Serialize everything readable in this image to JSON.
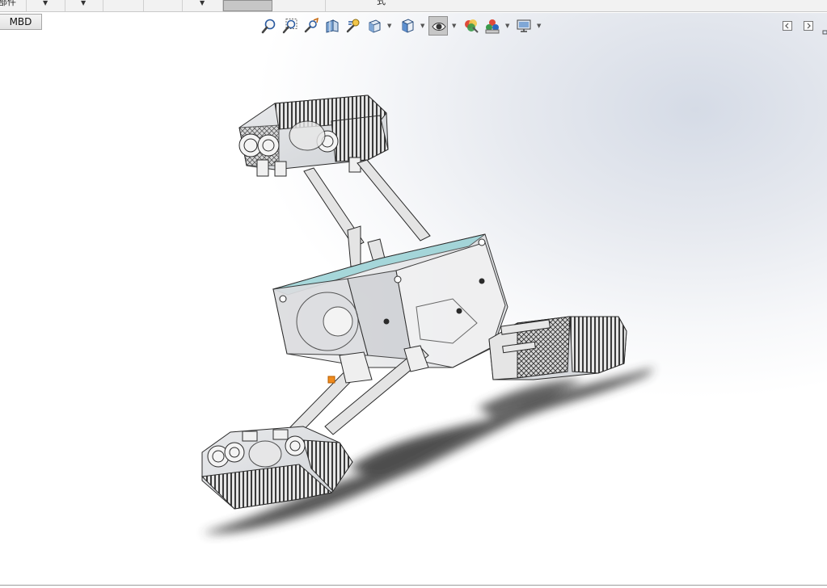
{
  "ribbon": {
    "partial_label": "部件",
    "cut_label": "式",
    "caret": "▼"
  },
  "tabs": {
    "mbd_label": "MBD"
  },
  "toolbar": {
    "caret": "▼",
    "tools": [
      {
        "name": "zoom-to-fit-icon"
      },
      {
        "name": "zoom-to-area-icon"
      },
      {
        "name": "previous-view-icon"
      },
      {
        "name": "section-view-icon"
      },
      {
        "name": "dynamic-annotation-icon"
      },
      {
        "name": "view-orientation-icon"
      },
      {
        "name": "display-style-icon"
      },
      {
        "name": "hide-show-items-icon"
      },
      {
        "name": "edit-appearance-icon"
      },
      {
        "name": "apply-scene-icon"
      },
      {
        "name": "view-settings-icon"
      }
    ]
  },
  "colors": {
    "accent_glass": "#8fd0d4",
    "part_line": "#2b2b2b",
    "shadow": "#3a3a3a",
    "highlight_orange": "#f08a1c"
  }
}
